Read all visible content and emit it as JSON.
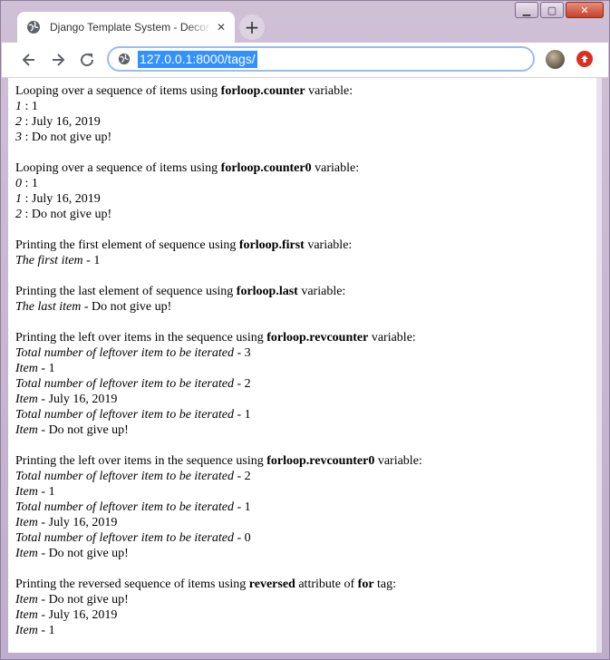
{
  "window": {
    "controls": {
      "minimize": "▁",
      "maximize": "▢",
      "close": "✕"
    }
  },
  "tab": {
    "title": "Django Template System - Decorators",
    "close": "✕",
    "new_tab": "+"
  },
  "toolbar": {
    "url": "127.0.0.1:8000/tags/",
    "accent": "#3390ff",
    "update_color": "#d93025"
  },
  "content": {
    "sections": [
      {
        "intro_prefix": "Looping over a sequence of items using ",
        "intro_bold": "forloop.counter",
        "intro_suffix": " variable:",
        "lines": [
          {
            "label": "1",
            "sep": " : ",
            "value": "1"
          },
          {
            "label": "2",
            "sep": " : ",
            "value": "July 16, 2019"
          },
          {
            "label": "3",
            "sep": " : ",
            "value": "Do not give up!"
          }
        ]
      },
      {
        "intro_prefix": "Looping over a sequence of items using ",
        "intro_bold": "forloop.counter0",
        "intro_suffix": " variable:",
        "lines": [
          {
            "label": "0",
            "sep": " : ",
            "value": "1"
          },
          {
            "label": "1",
            "sep": " : ",
            "value": "July 16, 2019"
          },
          {
            "label": "2",
            "sep": " : ",
            "value": "Do not give up!"
          }
        ]
      },
      {
        "intro_prefix": "Printing the first element of sequence using ",
        "intro_bold": "forloop.first",
        "intro_suffix": " variable:",
        "lines": [
          {
            "label": "The first item",
            "sep": " - ",
            "value": "1"
          }
        ]
      },
      {
        "intro_prefix": "Printing the last element of sequence using ",
        "intro_bold": "forloop.last",
        "intro_suffix": " variable:",
        "lines": [
          {
            "label": "The last item",
            "sep": " - ",
            "value": "Do not give up!"
          }
        ]
      },
      {
        "intro_prefix": "Printing the left over items in the sequence using ",
        "intro_bold": "forloop.revcounter",
        "intro_suffix": " variable:",
        "lines": [
          {
            "label": "Total number of leftover item to be iterated",
            "sep": " - ",
            "value": "3"
          },
          {
            "label": "Item",
            "sep": " - ",
            "value": "1"
          },
          {
            "label": "Total number of leftover item to be iterated",
            "sep": " - ",
            "value": "2"
          },
          {
            "label": "Item",
            "sep": " - ",
            "value": "July 16, 2019"
          },
          {
            "label": "Total number of leftover item to be iterated",
            "sep": " - ",
            "value": "1"
          },
          {
            "label": "Item",
            "sep": " - ",
            "value": "Do not give up!"
          }
        ]
      },
      {
        "intro_prefix": "Printing the left over items in the sequence using ",
        "intro_bold": "forloop.revcounter0",
        "intro_suffix": " variable:",
        "lines": [
          {
            "label": "Total number of leftover item to be iterated",
            "sep": " - ",
            "value": "2"
          },
          {
            "label": "Item",
            "sep": " - ",
            "value": "1"
          },
          {
            "label": "Total number of leftover item to be iterated",
            "sep": " - ",
            "value": "1"
          },
          {
            "label": "Item",
            "sep": " - ",
            "value": "July 16, 2019"
          },
          {
            "label": "Total number of leftover item to be iterated",
            "sep": " - ",
            "value": "0"
          },
          {
            "label": "Item",
            "sep": " - ",
            "value": "Do not give up!"
          }
        ]
      },
      {
        "intro_prefix": "Printing the reversed sequence of items using ",
        "intro_bold": "reversed",
        "intro_suffix": " attribute of ",
        "intro_bold2": "for",
        "intro_suffix2": " tag:",
        "lines": [
          {
            "label": "Item",
            "sep": " - ",
            "value": "Do not give up!"
          },
          {
            "label": "Item",
            "sep": " - ",
            "value": "July 16, 2019"
          },
          {
            "label": "Item",
            "sep": " - ",
            "value": "1"
          }
        ]
      }
    ]
  }
}
